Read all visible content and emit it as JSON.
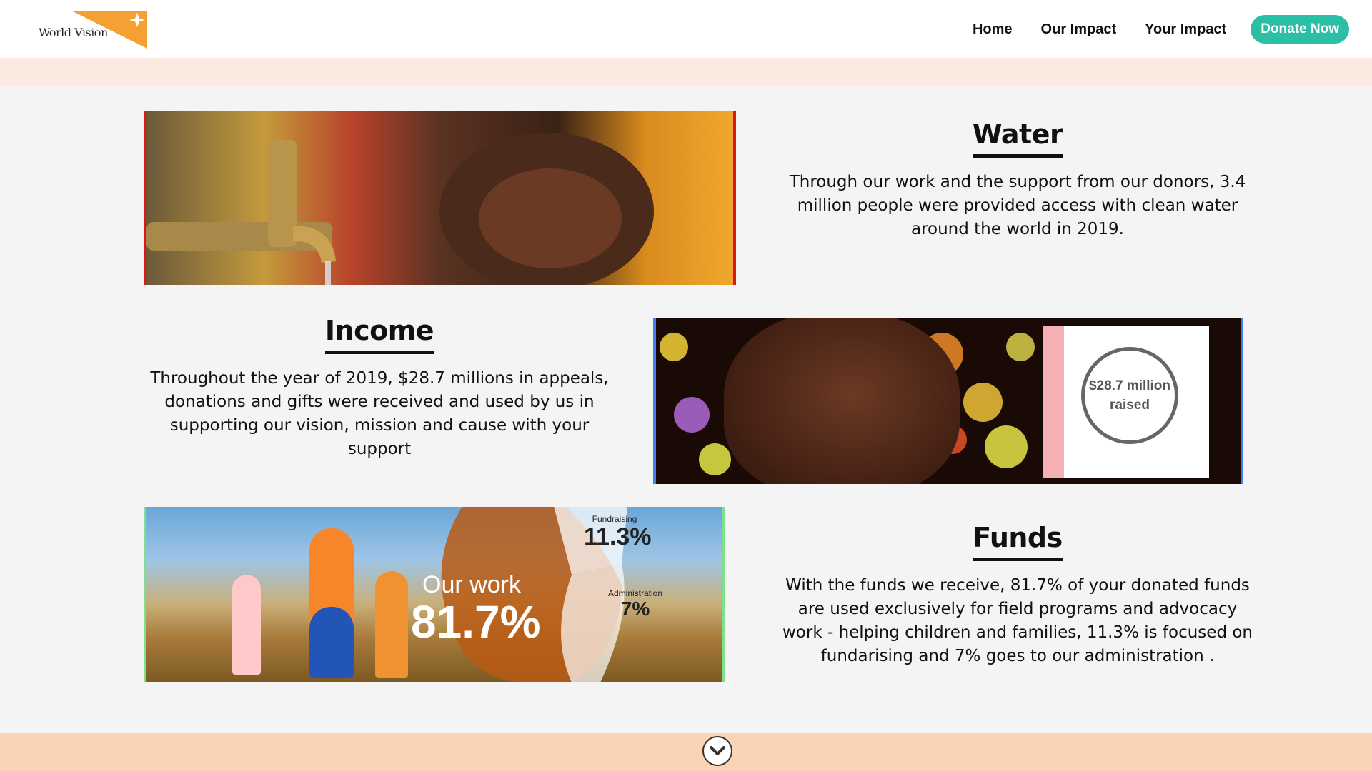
{
  "header": {
    "logo_text": "World Vision",
    "nav": [
      "Home",
      "Our Impact",
      "Your Impact"
    ],
    "donate_label": "Donate Now"
  },
  "sections": {
    "water": {
      "title": "Water",
      "body": "Through our work and the support from our donors, 3.4 million people were provided access with clean water around the world in 2019."
    },
    "income": {
      "title": "Income",
      "body": "Throughout the year of 2019, $28.7 millions in appeals, donations and gifts were received and used by us in supporting our vision, mission and cause with your support",
      "image_badge_line1": "$28.7 million",
      "image_badge_line2": "raised"
    },
    "funds": {
      "title": "Funds",
      "body": "With the funds we receive, 81.7% of your donated funds are used exclusively for field programs and advocacy work - helping children and families, 11.3% is focused on fundarising and 7% goes to our administration .",
      "image_work_label": "Our work",
      "image_work_value": "81.7%",
      "image_fundraising_label": "Fundraising",
      "image_fundraising_value": "11.3%",
      "image_admin_label": "Administration",
      "image_admin_value": "7%"
    }
  },
  "colors": {
    "accent_teal": "#2bbfa6",
    "logo_orange": "#f6a033",
    "band_light": "#faeadf",
    "band_bottom": "#fbd3b5",
    "water_border": "#e01515",
    "income_border": "#3b82f6",
    "funds_border": "#7ee08a"
  },
  "icons": {
    "logo": "world-vision-star-logo",
    "scroll": "chevron-down-icon"
  }
}
